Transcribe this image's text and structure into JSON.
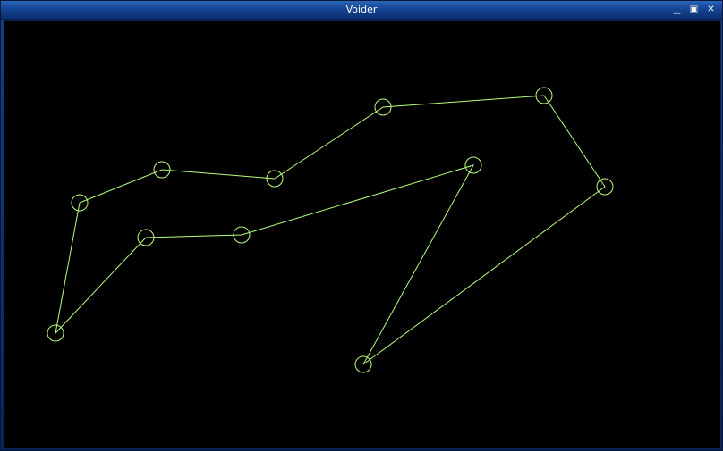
{
  "window": {
    "title": "Voider",
    "controls": {
      "minimize_icon": "minimize-icon",
      "maximize_icon": "maximize-icon",
      "close_icon": "close-icon"
    }
  },
  "canvas": {
    "background": "#000000",
    "stroke_color": "#b8ff7a"
  }
}
